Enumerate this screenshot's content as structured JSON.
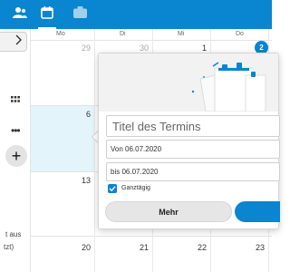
{
  "topbar": {
    "apps": [
      {
        "name": "contacts",
        "icon": "people-icon"
      },
      {
        "name": "calendar",
        "icon": "calendar-icon",
        "active": true
      },
      {
        "name": "tasks",
        "icon": "briefcase-icon"
      }
    ],
    "color": "#0a85cf"
  },
  "sidebar": {
    "add_label": "+",
    "note_line1": "t aus",
    "note_line2": "tzt)"
  },
  "calendar": {
    "days_of_week": [
      "Mo",
      "Di",
      "Mi",
      "Do"
    ],
    "week1": [
      "29",
      "30",
      "1",
      "2"
    ],
    "week2": [
      "6"
    ],
    "week3": [
      "13"
    ],
    "week4": [
      "20",
      "21",
      "22",
      "23"
    ],
    "today_bg": "#e3f4fb",
    "badge": "2"
  },
  "popover": {
    "title_placeholder": "Titel des Termins",
    "from": "Von 06.07.2020",
    "to": "bis 06.07.2020",
    "allday_label": "Ganztägig",
    "allday_checked": true,
    "more_label": "Mehr"
  }
}
